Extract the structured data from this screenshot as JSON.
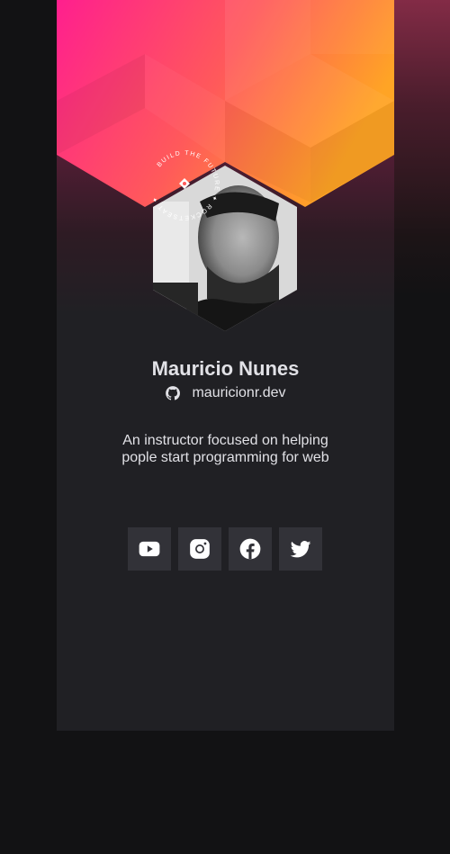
{
  "profile": {
    "name": "Mauricio Nunes",
    "github_handle": "mauricionr.dev",
    "bio_lines": [
      "An instructor focused on helping",
      "pople start programming for web"
    ],
    "badge_text": "BUILD THE FUTURE ✦ ROCKETSEAT ✦"
  },
  "socials": [
    {
      "name": "youtube",
      "icon": "youtube-icon"
    },
    {
      "name": "instagram",
      "icon": "instagram-icon"
    },
    {
      "name": "facebook",
      "icon": "facebook-icon"
    },
    {
      "name": "twitter",
      "icon": "twitter-icon"
    }
  ],
  "colors": {
    "page_background": "#121214",
    "card_background": "#202024",
    "button_background": "#323238",
    "text": "#e1e1e6",
    "gradient_start": "#ff1f8e",
    "gradient_end": "#ffa425"
  }
}
